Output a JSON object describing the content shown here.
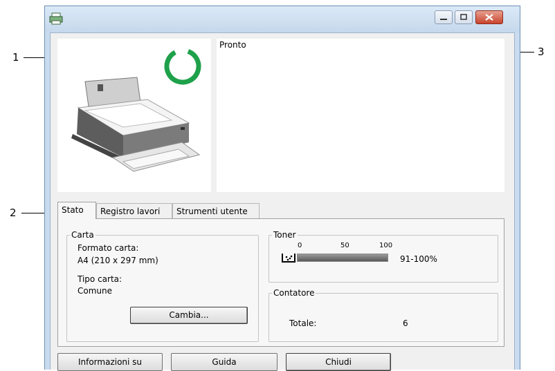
{
  "callouts": {
    "c1": "1",
    "c2": "2",
    "c3": "3"
  },
  "printer": {
    "status_message": "Pronto",
    "status_ring_color": "#1fa14b"
  },
  "tabs": [
    {
      "label": "Stato"
    },
    {
      "label": "Registro lavori"
    },
    {
      "label": "Strumenti utente"
    }
  ],
  "paper": {
    "group_title": "Carta",
    "size_label": "Formato carta:",
    "size_value": "A4 (210 x 297 mm)",
    "type_label": "Tipo carta:",
    "type_value": "Comune",
    "change_button": "Cambia..."
  },
  "toner": {
    "group_title": "Toner",
    "scale": [
      "0",
      "50",
      "100"
    ],
    "level_text": "91-100%",
    "level_fraction": 1.0
  },
  "counter": {
    "group_title": "Contatore",
    "total_label": "Totale:",
    "total_value": "6"
  },
  "footer": {
    "about_button": "Informazioni su",
    "help_button": "Guida",
    "close_button": "Chiudi"
  }
}
